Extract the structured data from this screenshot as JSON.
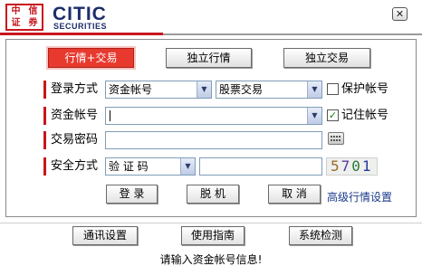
{
  "header": {
    "brand_name": "CITIC",
    "brand_sub": "SECURITIES",
    "seal_chars": [
      "中",
      "信",
      "证",
      "券"
    ],
    "close_label": "✕"
  },
  "mode_tabs": [
    {
      "label": "行情+交易",
      "active": true
    },
    {
      "label": "独立行情",
      "active": false
    },
    {
      "label": "独立交易",
      "active": false
    }
  ],
  "login": {
    "method_label": "登录方式",
    "method_value": "资金帐号",
    "market_value": "股票交易",
    "protect_label": "保护帐号",
    "protect_checked": false,
    "account_label": "资金帐号",
    "account_value": "",
    "remember_label": "记住帐号",
    "remember_checked": true,
    "password_label": "交易密码",
    "password_value": "",
    "security_label": "安全方式",
    "security_value": "验 证 码",
    "captcha_input_value": "",
    "captcha_text": "5701"
  },
  "actions": {
    "login": "登 录",
    "offline": "脱 机",
    "cancel": "取 消",
    "advanced": "高级行情设置"
  },
  "footer": {
    "comm_settings": "通讯设置",
    "user_guide": "使用指南",
    "system_check": "系统检测",
    "status": "请输入资金帐号信息!"
  },
  "colors": {
    "brand_red": "#c8161d",
    "brand_navy": "#1d2d6b",
    "active_tab": "#e8392f",
    "link": "#1a3a8a"
  },
  "icons": [
    "close-icon",
    "keyboard-icon",
    "dropdown-arrow-icon",
    "checkmark-icon"
  ]
}
